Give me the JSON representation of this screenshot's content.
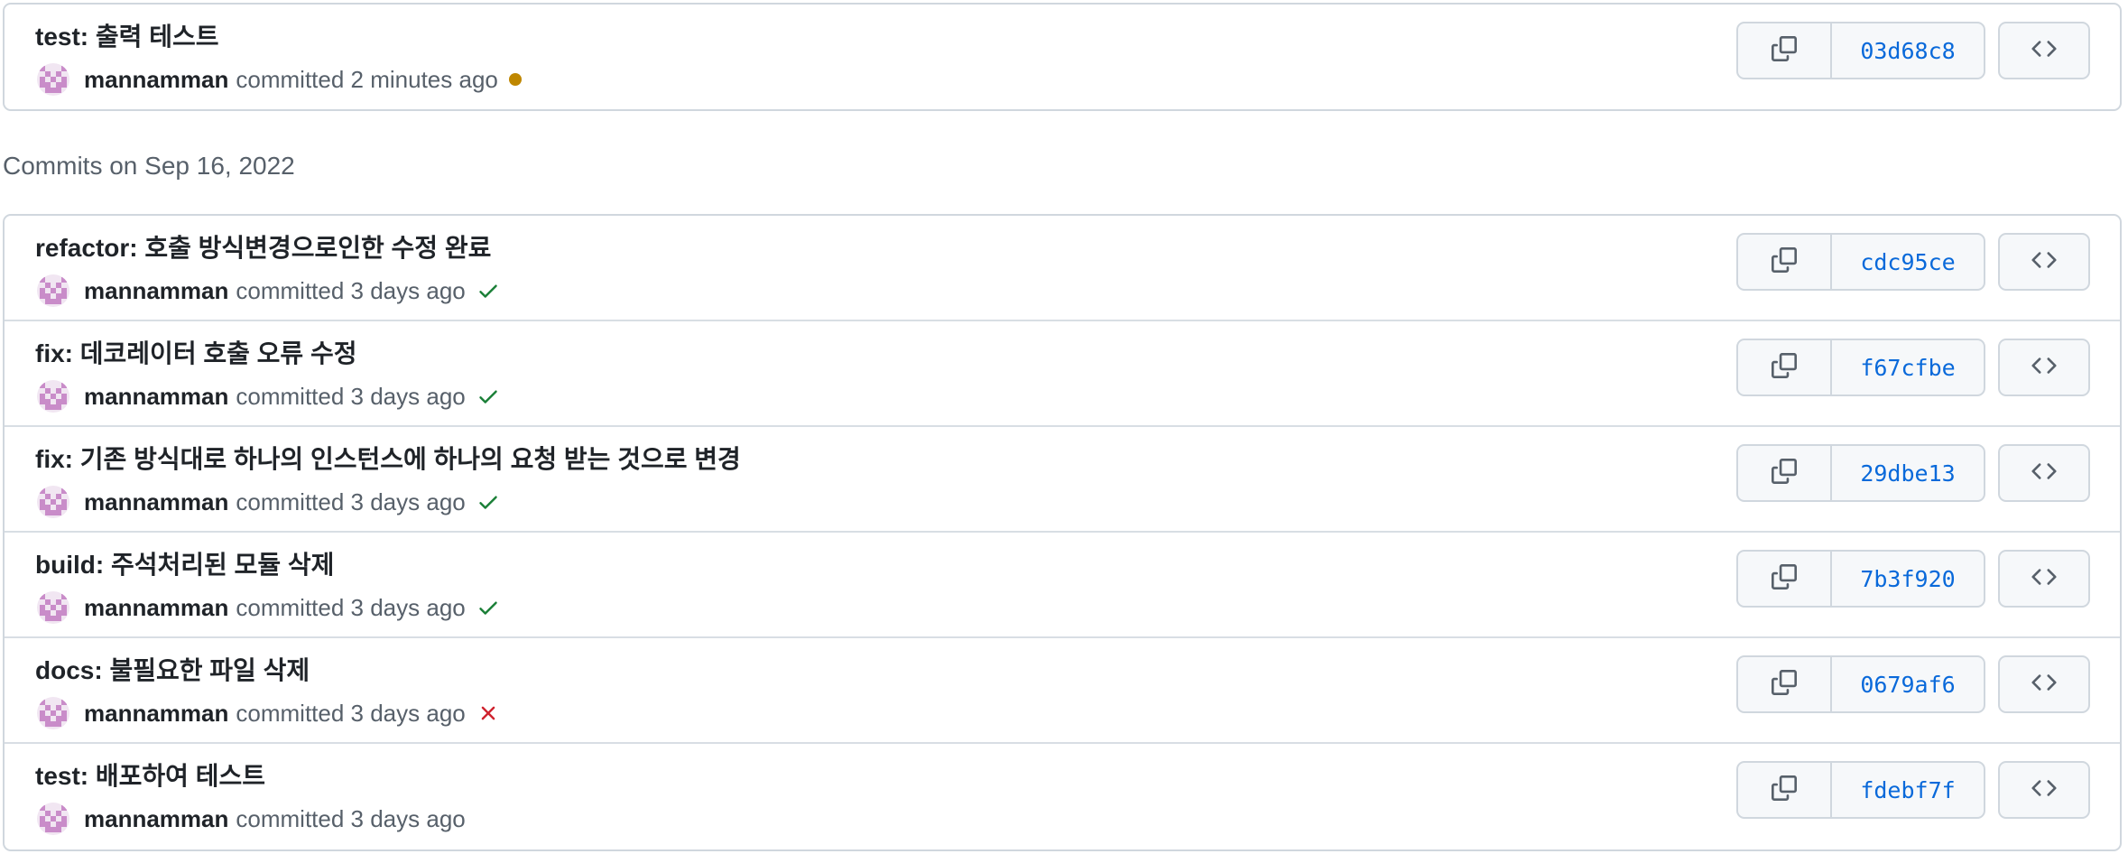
{
  "top_commit": {
    "message": "test: 출력 테스트",
    "author": "mannamman",
    "time": "committed 2 minutes ago",
    "status": "pending",
    "sha": "03d68c8"
  },
  "date_heading": "Commits on Sep 16, 2022",
  "commits": [
    {
      "message": "refactor: 호출 방식변경으로인한 수정 완료",
      "author": "mannamman",
      "time": "committed 3 days ago",
      "status": "success",
      "sha": "cdc95ce"
    },
    {
      "message": "fix: 데코레이터 호출 오류 수정",
      "author": "mannamman",
      "time": "committed 3 days ago",
      "status": "success",
      "sha": "f67cfbe"
    },
    {
      "message": "fix: 기존 방식대로 하나의 인스턴스에 하나의 요청 받는 것으로 변경",
      "author": "mannamman",
      "time": "committed 3 days ago",
      "status": "success",
      "sha": "29dbe13"
    },
    {
      "message": "build: 주석처리된 모듈 삭제",
      "author": "mannamman",
      "time": "committed 3 days ago",
      "status": "success",
      "sha": "7b3f920"
    },
    {
      "message": "docs: 불필요한 파일 삭제",
      "author": "mannamman",
      "time": "committed 3 days ago",
      "status": "failure",
      "sha": "0679af6"
    },
    {
      "message": "test: 배포하여 테스트",
      "author": "mannamman",
      "time": "committed 3 days ago",
      "status": "none",
      "sha": "fdebf7f"
    }
  ],
  "icons": {
    "copy": "copy-icon",
    "browse": "code-icon",
    "success": "check-icon",
    "failure": "x-icon",
    "pending": "dot-icon"
  },
  "colors": {
    "link": "#0969da",
    "success": "#1a7f37",
    "failure": "#cf222e",
    "pending": "#bf8700"
  }
}
